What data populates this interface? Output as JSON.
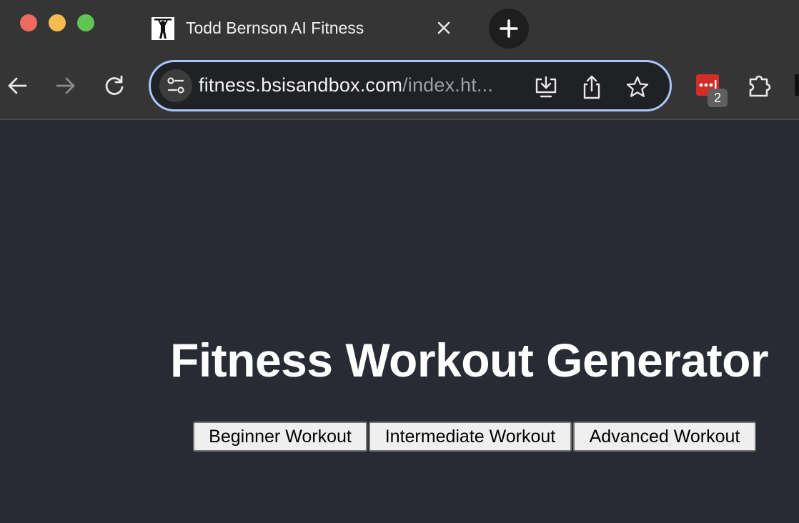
{
  "browser": {
    "tab": {
      "title": "Todd Bernson AI Fitness"
    },
    "address": {
      "host": "fitness.bsisandbox.com",
      "path": "/index.ht..."
    },
    "extension_badge": "2",
    "icons": {
      "back": "arrow-left-icon",
      "forward": "arrow-right-icon",
      "reload": "reload-icon",
      "site_info": "tune-icon",
      "install": "install-app-icon",
      "share": "share-icon",
      "bookmark": "star-icon",
      "password_manager": "lastpass-icon",
      "extensions": "puzzle-icon",
      "close_tab": "close-icon",
      "new_tab": "plus-icon"
    },
    "colors": {
      "focus_ring": "#a8c7fa",
      "traffic_red": "#ee6a5f",
      "traffic_yellow": "#f5bd4f",
      "traffic_green": "#61c454"
    }
  },
  "page": {
    "heading": "Fitness Workout Generator",
    "buttons": [
      {
        "label": "Beginner Workout"
      },
      {
        "label": "Intermediate Workout"
      },
      {
        "label": "Advanced Workout"
      }
    ],
    "colors": {
      "background": "#282b33",
      "heading": "#ffffff"
    }
  }
}
